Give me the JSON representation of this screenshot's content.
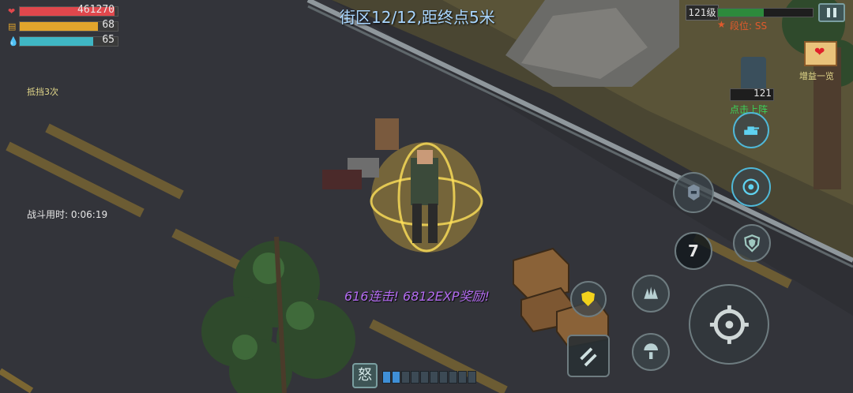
{
  "hud": {
    "hp_value": "461270",
    "energy_value": "68",
    "mana_value": "65",
    "hp_fraction": 0.97,
    "energy_fraction": 0.8,
    "mana_fraction": 0.75,
    "block_text": "抵挡3次",
    "battle_time_text": "战斗用时: 0:06:19"
  },
  "top": {
    "stage_text": "街区12/12,距终点5米",
    "level_text": "121级",
    "rank_text": "段位: SS",
    "buff_label": "增益一览"
  },
  "companion": {
    "level": "121",
    "deploy_label": "点击上阵"
  },
  "combat": {
    "combo_text": "616连击! 6812EXP奖励!"
  },
  "skills": {
    "cooldown_value": "7"
  },
  "rage": {
    "label": "怒",
    "filled_segments": 2,
    "total_segments": 10
  },
  "colors": {
    "hp": "#e0474c",
    "energy": "#e2a52c",
    "mana": "#3fb6c4",
    "xp": "#2d8a3c",
    "combo": "#b36cf0",
    "stage_text": "#a9d6ff"
  }
}
